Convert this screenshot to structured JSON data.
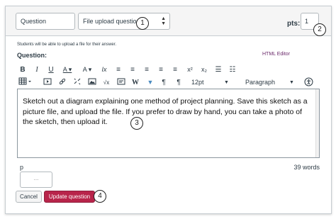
{
  "header": {
    "question_name": "Question",
    "question_type": "File upload question",
    "pts_label": "pts:",
    "pts_value": "1"
  },
  "body": {
    "note": "Students will be able to upload a file for their answer.",
    "question_label": "Question:",
    "html_editor_link": "HTML Editor",
    "editor_text": "Sketch out a diagram explaining one method of project planning. Save this sketch as a picture file, and upload the file. If you prefer to draw by hand, you can take a photo of the sketch, then upload it.",
    "status_path": "p",
    "word_count": "39 words",
    "answer_placeholder": "..."
  },
  "toolbar": {
    "row1": [
      "B",
      "I",
      "U",
      "A ▾",
      "A ▾",
      "Ix",
      "≡",
      "≡",
      "≡",
      "≡",
      "≡",
      "x²",
      "x₂",
      "☰",
      "☷"
    ],
    "row2": {
      "font_size": "12pt",
      "paragraph": "Paragraph",
      "w_label": "W",
      "pilcrow1": "¶",
      "pilcrow2": "¶"
    }
  },
  "buttons": {
    "cancel": "Cancel",
    "update": "Update question"
  },
  "callouts": [
    "1",
    "2",
    "3",
    "4"
  ],
  "colors": {
    "update_button": "#b8244a",
    "html_editor_link": "#6b2a6b",
    "header_bg": "#f5f5f5"
  }
}
